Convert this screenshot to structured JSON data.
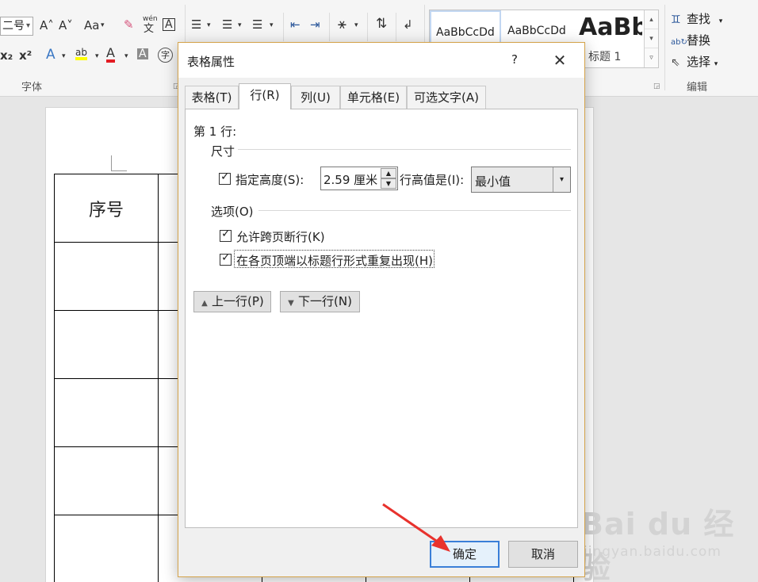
{
  "ribbon": {
    "font_size_value": "二号",
    "grow_font": "A˄",
    "shrink_font": "A˅",
    "change_case": "Aa",
    "phonetic_top": "wén",
    "phonetic_bottom": "文",
    "char_border": "A",
    "subscript": "x₂",
    "superscript": "x²",
    "text_effects": "A",
    "highlight": "ab",
    "font_color": "A",
    "char_shading": "A",
    "enclose": "字",
    "font_group_label": "字体",
    "styles": [
      {
        "sample": "AaBbCcDd",
        "name": ""
      },
      {
        "sample": "AaBbCcDd",
        "name": ""
      },
      {
        "sample": "AaBb",
        "name": "标题 1"
      }
    ],
    "editing_group_label": "编辑",
    "find_label": "查找",
    "replace_label": "替换",
    "select_label": "选择"
  },
  "document": {
    "header_cell": "序号"
  },
  "dialog": {
    "title": "表格属性",
    "help": "?",
    "close": "✕",
    "tabs": [
      "表格(T)",
      "行(R)",
      "列(U)",
      "单元格(E)",
      "可选文字(A)"
    ],
    "active_tab_index": 1,
    "row_heading": "第 1 行:",
    "size_section": "尺寸",
    "specify_height_label": "指定高度(S):",
    "specify_height_checked": true,
    "height_value": "2.59 厘米",
    "row_height_is_label": "行高值是(I):",
    "row_height_is_value": "最小值",
    "options_section": "选项(O)",
    "allow_break_label": "允许跨页断行(K)",
    "allow_break_checked": true,
    "repeat_header_label": "在各页顶端以标题行形式重复出现(H)",
    "repeat_header_checked": true,
    "prev_row_label": "上一行(P)",
    "next_row_label": "下一行(N)",
    "ok_label": "确定",
    "cancel_label": "取消"
  },
  "watermark": {
    "logo": "Bai du 经验",
    "url": "jingyan.baidu.com"
  },
  "colors": {
    "accent_blue": "#3a7fd8",
    "annotation_arrow": "#e8322d",
    "font_color_bar": "#e31c23",
    "highlight_bar": "#ffff00"
  }
}
